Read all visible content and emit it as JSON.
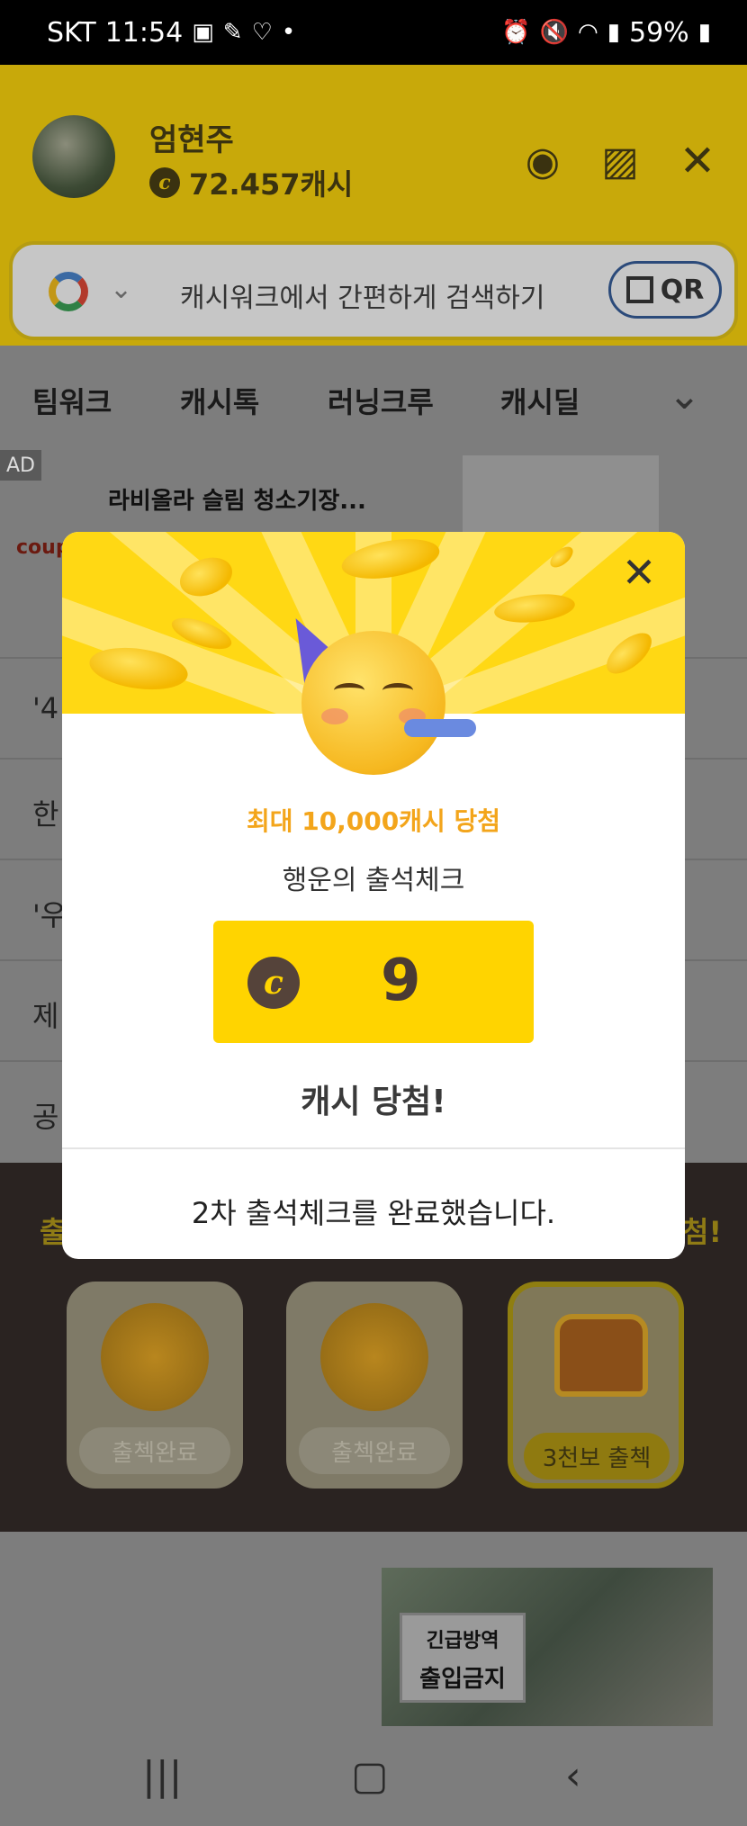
{
  "status": {
    "carrier": "SKT",
    "time": "11:54",
    "battery": "59%"
  },
  "header": {
    "name": "엄현주",
    "cash": "72.457캐시"
  },
  "search": {
    "placeholder": "캐시워크에서 간편하게 검색하기",
    "qr_label": "QR"
  },
  "tabs": [
    "팀워크",
    "캐시톡",
    "러닝크루",
    "캐시딜"
  ],
  "ad": {
    "badge": "AD",
    "title": "라비올라 슬림 청소기장...",
    "brand": "coupa"
  },
  "list_rows": [
    "'4",
    "한",
    "'우",
    "제",
    "공"
  ],
  "attendance": {
    "title_char": "출",
    "right_char": "첨!",
    "cards": [
      {
        "label": "출첵완료"
      },
      {
        "label": "출첵완료"
      },
      {
        "label": "3천보 출첵"
      }
    ]
  },
  "news": {
    "sign_top": "긴급방역",
    "sign_main": "출입금지"
  },
  "modal": {
    "headline": "최대 10,000캐시 당첨",
    "subline": "행운의 출석체크",
    "coin_symbol": "c",
    "prize": "9",
    "win_text": "캐시 당첨!",
    "footer": "2차 출석체크를 완료했습니다."
  },
  "colors": {
    "brand_yellow": "#ffd814",
    "accent_orange": "#f3a51b",
    "dark_brown": "#4a3a33"
  }
}
